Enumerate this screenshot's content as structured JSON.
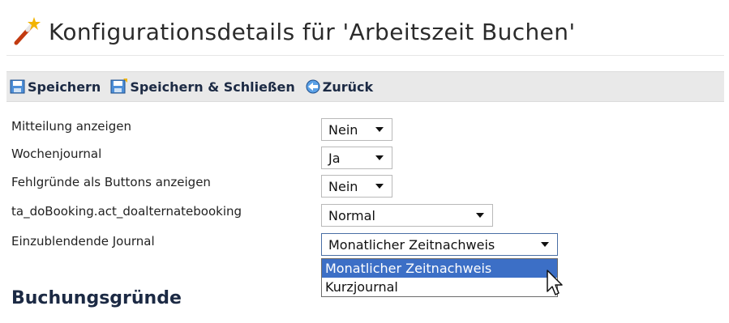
{
  "header": {
    "title": "Konfigurationsdetails für 'Arbeitszeit Buchen'",
    "icon": "magic-wand-icon"
  },
  "toolbar": {
    "save_label": "Speichern",
    "save_icon": "save-icon",
    "save_close_label": "Speichern & Schließen",
    "save_close_icon": "save-close-icon",
    "back_label": "Zurück",
    "back_icon": "back-arrow-icon"
  },
  "form": {
    "rows": [
      {
        "label": "Mitteilung anzeigen",
        "value": "Nein"
      },
      {
        "label": "Wochenjournal",
        "value": "Ja"
      },
      {
        "label": "Fehlgründe als Buttons anzeigen",
        "value": "Nein"
      },
      {
        "label": "ta_doBooking.act_doalternatebooking",
        "value": "Normal"
      },
      {
        "label": "Einzublendende Journal",
        "value": "Monatlicher Zeitnachweis"
      }
    ],
    "journal_dropdown_options": [
      {
        "label": "Monatlicher Zeitnachweis",
        "selected": true
      },
      {
        "label": "Kurzjournal",
        "selected": false
      }
    ]
  },
  "section": {
    "heading": "Buchungsgründe"
  },
  "colors": {
    "toolbar_bg": "#e9e9e9",
    "selected_option_bg": "#3c6fc6",
    "heading_color": "#1c2a44"
  }
}
